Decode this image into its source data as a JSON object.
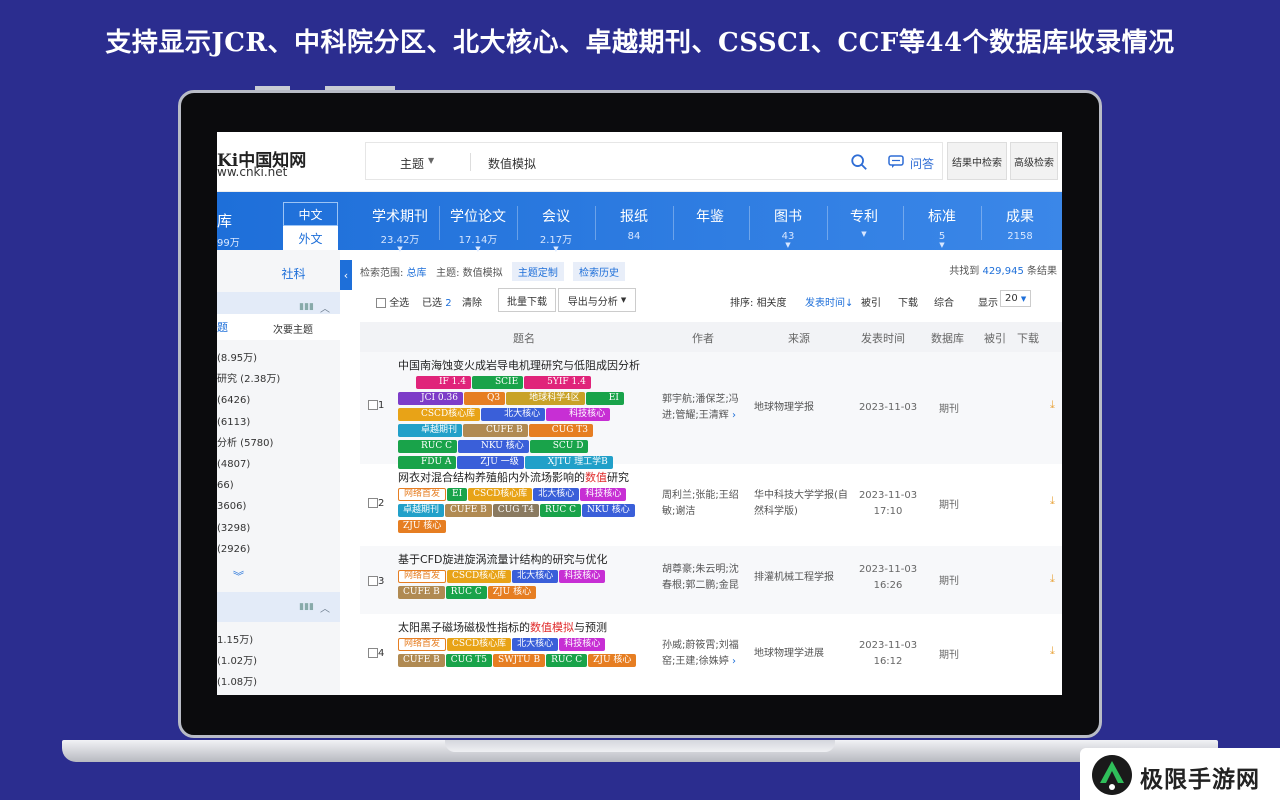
{
  "banner": "支持显示JCR、中科院分区、北大核心、卓越期刊、CSSCI、CCF等44个数据库收录情况",
  "header": {
    "logo_cn": "Ki中国知网",
    "logo_url": "ww.cnki.net",
    "search_field": "主题",
    "search_text": "数值模拟",
    "ask": "问答",
    "in_result": "结果中检索",
    "advanced": "高级检索"
  },
  "nav": {
    "db_label": "库",
    "db_count": "99万",
    "lang_cn": "中文",
    "lang_en": "外文",
    "items": [
      {
        "label": "学术期刊",
        "count": "23.42万"
      },
      {
        "label": "学位论文",
        "count": "17.14万"
      },
      {
        "label": "会议",
        "count": "2.17万"
      },
      {
        "label": "报纸",
        "count": "84"
      },
      {
        "label": "年鉴",
        "count": ""
      },
      {
        "label": "图书",
        "count": "43"
      },
      {
        "label": "专利",
        "count": ""
      },
      {
        "label": "标准",
        "count": "5"
      },
      {
        "label": "成果",
        "count": "2158"
      }
    ]
  },
  "sidebar": {
    "tab": "社科",
    "sub_main": "题",
    "sub_secondary": "次要主题",
    "items": [
      "(8.95万)",
      "研究 (2.38万)",
      "(6426)",
      "(6113)",
      "分析 (5780)",
      "(4807)",
      "66)",
      "3606)",
      "(3298)",
      "(2926)"
    ],
    "items2": [
      "1.15万)",
      "(1.02万)",
      "(1.08万)"
    ]
  },
  "results": {
    "scope_label": "检索范围:",
    "scope_value": "总库",
    "scope_theme": "主题: 数值模拟",
    "chip1": "主题定制",
    "chip2": "检索历史",
    "found_prefix": "共找到",
    "found_count": "429,945",
    "found_suffix": "条结果",
    "select_all": "全选",
    "selected": "已选",
    "selected_count": "2",
    "clear": "清除",
    "bulk_download": "批量下载",
    "export": "导出与分析",
    "sort_label": "排序:",
    "sort_relevance": "相关度",
    "sort_date": "发表时间",
    "sort_cited": "被引",
    "sort_download": "下载",
    "sort_overall": "综合",
    "show_label": "显示",
    "show_value": "20",
    "columns": {
      "title": "题名",
      "author": "作者",
      "source": "来源",
      "date": "发表时间",
      "db": "数据库",
      "cited": "被引",
      "download": "下载"
    },
    "rows": [
      {
        "num": "1",
        "title_pre": "中国南海蚀变火成岩导电机理研究与低阻成因分析",
        "title_hl": "",
        "title_post": "",
        "author": "郭宇航;潘保芝;冯进;管耀;王清辉",
        "source": "地球物理学报",
        "date1": "2023-11-03",
        "date2": "",
        "db": "期刊"
      },
      {
        "num": "2",
        "title_pre": "网衣对混合结构养殖船内外流场影响的",
        "title_hl": "数值",
        "title_post": "研究",
        "author": "周利兰;张能;王绍敏;谢洁",
        "source": "华中科技大学学报(自然科学版)",
        "date1": "2023-11-03",
        "date2": "17:10",
        "db": "期刊"
      },
      {
        "num": "3",
        "title_pre": "基于CFD旋进旋涡流量计结构的研究与优化",
        "title_hl": "",
        "title_post": "",
        "author": "胡尊豪;朱云明;沈春根;郭二鹏;金昆",
        "source": "排灌机械工程学报",
        "date1": "2023-11-03",
        "date2": "16:26",
        "db": "期刊"
      },
      {
        "num": "4",
        "title_pre": "太阳黑子磁场磁极性指标的",
        "title_hl": "数值模拟",
        "title_post": "与预测",
        "author": "孙威;蔚筱霄;刘福窑;王建;徐姝婷",
        "source": "地球物理学进展",
        "date1": "2023-11-03",
        "date2": "16:12",
        "db": "期刊"
      }
    ],
    "tags": [
      [
        {
          "t": "IF 1.4",
          "c": "#e0247a"
        },
        {
          "t": "SCIE",
          "c": "#19a34a"
        },
        {
          "t": "5YIF 1.4",
          "c": "#e0247a"
        },
        {
          "t": "JCI 0.36",
          "c": "#7d3cc8"
        },
        {
          "t": "Q3",
          "c": "#e67e22"
        },
        {
          "t": "地球科学4区",
          "c": "#c9a227"
        },
        {
          "t": "EI",
          "c": "#19a34a"
        },
        {
          "t": "CSCD核心库",
          "c": "#e8a317"
        },
        {
          "t": "北大核心",
          "c": "#3a5fd9"
        },
        {
          "t": "科技核心",
          "c": "#c72fd4"
        },
        {
          "t": "卓越期刊",
          "c": "#21a0c9"
        },
        {
          "t": "CUFE B",
          "c": "#b08a52"
        },
        {
          "t": "CUG T3",
          "c": "#e67e22"
        },
        {
          "t": "RUC C",
          "c": "#19a34a"
        },
        {
          "t": "NKU 核心",
          "c": "#3a5fd9"
        },
        {
          "t": "SCU D",
          "c": "#19a34a"
        },
        {
          "t": "FDU A",
          "c": "#19a34a"
        },
        {
          "t": "ZJU 一级",
          "c": "#3a5fd9"
        },
        {
          "t": "XJTU 理工学B",
          "c": "#21a0c9"
        }
      ],
      [
        {
          "t": "网络首发",
          "c": "outline"
        },
        {
          "t": "EI",
          "c": "#19a34a"
        },
        {
          "t": "CSCD核心库",
          "c": "#e8a317"
        },
        {
          "t": "北大核心",
          "c": "#3a5fd9"
        },
        {
          "t": "科技核心",
          "c": "#c72fd4"
        },
        {
          "t": "卓越期刊",
          "c": "#21a0c9"
        },
        {
          "t": "CUFE B",
          "c": "#b08a52"
        },
        {
          "t": "CUG T4",
          "c": "#8a7a60"
        },
        {
          "t": "RUC C",
          "c": "#19a34a"
        },
        {
          "t": "NKU 核心",
          "c": "#3a5fd9"
        },
        {
          "t": "ZJU 核心",
          "c": "#e67e22"
        }
      ],
      [
        {
          "t": "网络首发",
          "c": "outline"
        },
        {
          "t": "CSCD核心库",
          "c": "#e8a317"
        },
        {
          "t": "北大核心",
          "c": "#3a5fd9"
        },
        {
          "t": "科技核心",
          "c": "#c72fd4"
        },
        {
          "t": "CUFE B",
          "c": "#b08a52"
        },
        {
          "t": "RUC C",
          "c": "#19a34a"
        },
        {
          "t": "ZJU 核心",
          "c": "#e67e22"
        }
      ],
      [
        {
          "t": "网络首发",
          "c": "outline"
        },
        {
          "t": "CSCD核心库",
          "c": "#e8a317"
        },
        {
          "t": "北大核心",
          "c": "#3a5fd9"
        },
        {
          "t": "科技核心",
          "c": "#c72fd4"
        },
        {
          "t": "CUFE B",
          "c": "#b08a52"
        },
        {
          "t": "CUG T5",
          "c": "#19a34a"
        },
        {
          "t": "SWJTU B",
          "c": "#e67e22"
        },
        {
          "t": "RUC C",
          "c": "#19a34a"
        },
        {
          "t": "ZJU 核心",
          "c": "#e67e22"
        }
      ]
    ]
  },
  "watermark": "极限手游网",
  "colors": {
    "bg": "#2b2d8f",
    "primary": "#1e6fd9",
    "highlight": "#e02a2a"
  }
}
